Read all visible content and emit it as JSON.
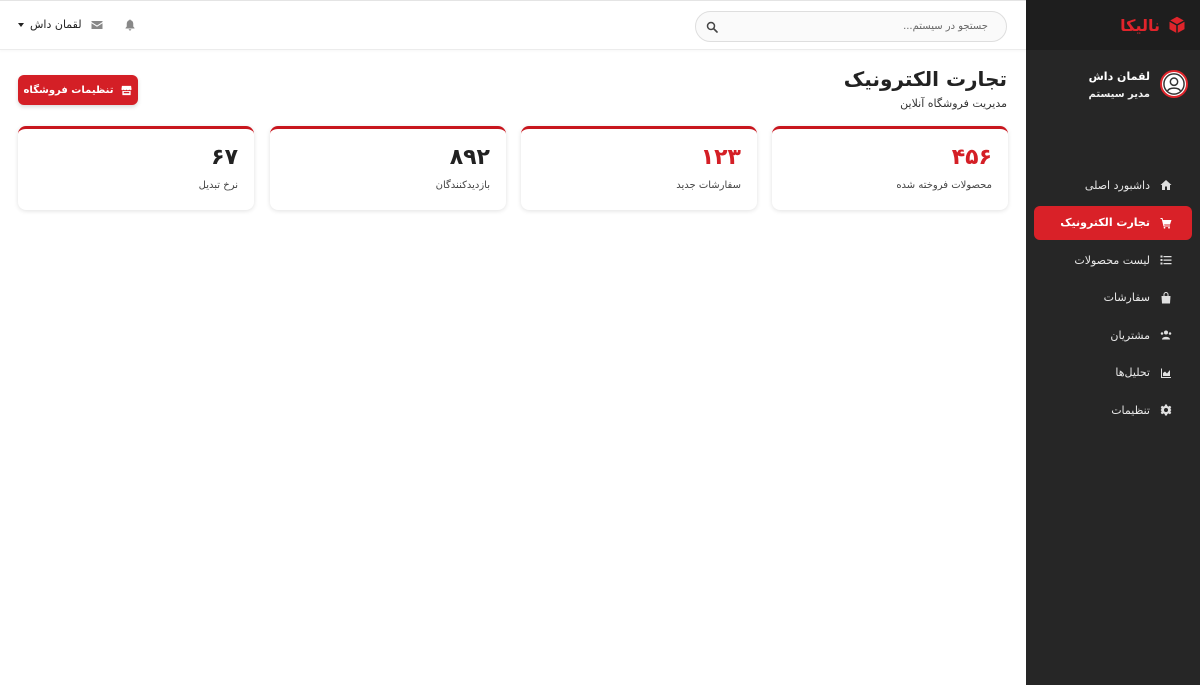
{
  "brand": {
    "name": "نالیکا",
    "icon": "cube-icon",
    "accent_color": "#e0242b"
  },
  "sidebar": {
    "profile": {
      "name": "لقمان داش",
      "role": "مدیر سیستم",
      "icon": "user-circle-icon"
    },
    "items": [
      {
        "label": "داشبورد اصلی",
        "icon": "home-icon",
        "active": false
      },
      {
        "label": "تجارت الکترونیک",
        "icon": "cart-icon",
        "active": true
      },
      {
        "label": "لیست محصولات",
        "icon": "list-icon",
        "active": false
      },
      {
        "label": "سفارشات",
        "icon": "shopping-bag-icon",
        "active": false
      },
      {
        "label": "مشتریان",
        "icon": "users-icon",
        "active": false
      },
      {
        "label": "تحلیل‌ها",
        "icon": "chart-icon",
        "active": false
      },
      {
        "label": "تنظیمات",
        "icon": "gear-icon",
        "active": false
      }
    ]
  },
  "header": {
    "search": {
      "placeholder": "جستجو در سیستم..."
    },
    "user_name": "لقمان داش",
    "icons": [
      "bell-icon",
      "envelope-icon",
      "caret-down-icon"
    ]
  },
  "page": {
    "title": "تجارت الکترونیک",
    "subtitle": "مدیریت فروشگاه آنلاین",
    "store_button_label": "تنظیمات فروشگاه"
  },
  "stats": [
    {
      "value": "۴۵۶",
      "label": "محصولات فروخته شده"
    },
    {
      "value": "۱۲۳",
      "label": "سفارشات جدید"
    },
    {
      "value": "۸۹۲",
      "label": "بازدیدکنندگان"
    },
    {
      "value": "۶۷",
      "label": "نرخ تبدیل"
    }
  ]
}
